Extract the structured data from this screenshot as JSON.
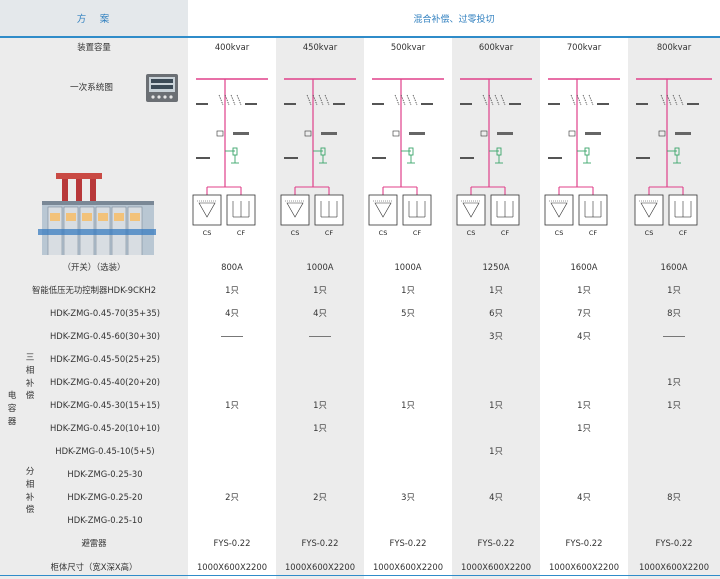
{
  "header": {
    "left": "方　案",
    "right": "混合补偿、过零投切"
  },
  "capacity": {
    "label": "装置容量",
    "values": [
      "400kvar",
      "450kvar",
      "500kvar",
      "600kvar",
      "700kvar",
      "800kvar"
    ]
  },
  "diagram": {
    "label": "一次系统图",
    "cs_label": "CS",
    "cf_label": "CF"
  },
  "switch": {
    "label": "（开关）（选装）",
    "values": [
      "800A",
      "1000A",
      "1000A",
      "1250A",
      "1600A",
      "1600A"
    ]
  },
  "controller": {
    "label": "智能低压无功控制器HDK-9CKH2",
    "values": [
      "1只",
      "1只",
      "1只",
      "1只",
      "1只",
      "1只"
    ]
  },
  "capacitor_group": {
    "outer_label": "电容器",
    "three_phase_label": "三相补偿",
    "split_phase_label": "分相补偿"
  },
  "capacitor_rows": [
    {
      "model": "HDK-ZMG-0.45-70(35+35)",
      "values": [
        "4只",
        "4只",
        "5只",
        "6只",
        "7只",
        "8只"
      ]
    },
    {
      "model": "HDK-ZMG-0.45-60(30+30)",
      "values": [
        "——",
        "——",
        "",
        "3只",
        "4只",
        "——"
      ]
    },
    {
      "model": "HDK-ZMG-0.45-50(25+25)",
      "values": [
        "",
        "",
        "",
        "",
        "",
        ""
      ]
    },
    {
      "model": "HDK-ZMG-0.45-40(20+20)",
      "values": [
        "",
        "",
        "",
        "",
        "",
        "1只"
      ]
    },
    {
      "model": "HDK-ZMG-0.45-30(15+15)",
      "values": [
        "1只",
        "1只",
        "1只",
        "1只",
        "1只",
        "1只"
      ]
    },
    {
      "model": "HDK-ZMG-0.45-20(10+10)",
      "values": [
        "",
        "1只",
        "",
        "",
        "1只",
        ""
      ]
    },
    {
      "model": "HDK-ZMG-0.45-10(5+5)",
      "values": [
        "",
        "",
        "",
        "1只",
        "",
        ""
      ]
    },
    {
      "model": "HDK-ZMG-0.25-30",
      "values": [
        "",
        "",
        "",
        "",
        "",
        ""
      ]
    },
    {
      "model": "HDK-ZMG-0.25-20",
      "values": [
        "2只",
        "2只",
        "3只",
        "4只",
        "4只",
        "8只"
      ]
    },
    {
      "model": "HDK-ZMG-0.25-10",
      "values": [
        "",
        "",
        "",
        "",
        "",
        ""
      ]
    }
  ],
  "arrester": {
    "label": "避雷器",
    "values": [
      "FYS-0.22",
      "FYS-0.22",
      "FYS-0.22",
      "FYS-0.22",
      "FYS-0.22",
      "FYS-0.22"
    ]
  },
  "size": {
    "label": "柜体尺寸（宽X深X高）",
    "values": [
      "1000X600X2200",
      "1000X600X2200",
      "1000X600X2200",
      "1000X600X2200",
      "1000X600X2200",
      "1000X600X2200"
    ]
  },
  "colors": {
    "accent": "#2f8cc9",
    "busbar": "#e0408a",
    "green": "#3aa66a",
    "grey_bg": "#ececec"
  }
}
